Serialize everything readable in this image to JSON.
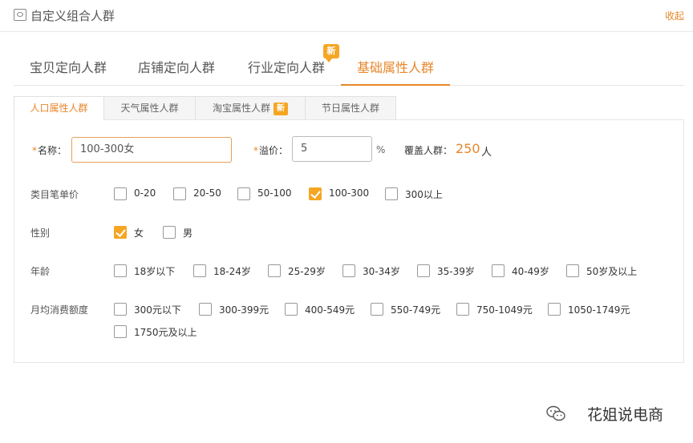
{
  "header": {
    "title": "自定义组合人群",
    "collapse": "收起"
  },
  "main_tabs": [
    {
      "label": "宝贝定向人群"
    },
    {
      "label": "店铺定向人群"
    },
    {
      "label": "行业定向人群",
      "badge": "新"
    },
    {
      "label": "基础属性人群",
      "active": true
    }
  ],
  "sub_tabs": [
    {
      "label": "人口属性人群",
      "active": true
    },
    {
      "label": "天气属性人群"
    },
    {
      "label": "淘宝属性人群",
      "badge": "新"
    },
    {
      "label": "节日属性人群"
    }
  ],
  "form": {
    "name_label": "名称：",
    "name_value": "100-300女",
    "premium_label": "溢价：",
    "premium_value": "5",
    "premium_unit": "%",
    "cover_label": "覆盖人群：",
    "cover_value": "250",
    "cover_unit": "人",
    "required_mark": "*"
  },
  "rows": {
    "price": {
      "label": "类目笔单价",
      "options": [
        {
          "label": "0-20",
          "checked": false
        },
        {
          "label": "20-50",
          "checked": false
        },
        {
          "label": "50-100",
          "checked": false
        },
        {
          "label": "100-300",
          "checked": true
        },
        {
          "label": "300以上",
          "checked": false
        }
      ]
    },
    "gender": {
      "label": "性别",
      "options": [
        {
          "label": "女",
          "checked": true
        },
        {
          "label": "男",
          "checked": false
        }
      ]
    },
    "age": {
      "label": "年龄",
      "options": [
        {
          "label": "18岁以下",
          "checked": false
        },
        {
          "label": "18-24岁",
          "checked": false
        },
        {
          "label": "25-29岁",
          "checked": false
        },
        {
          "label": "30-34岁",
          "checked": false
        },
        {
          "label": "35-39岁",
          "checked": false
        },
        {
          "label": "40-49岁",
          "checked": false
        },
        {
          "label": "50岁及以上",
          "checked": false
        }
      ]
    },
    "spend": {
      "label": "月均消费额度",
      "options": [
        {
          "label": "300元以下",
          "checked": false
        },
        {
          "label": "300-399元",
          "checked": false
        },
        {
          "label": "400-549元",
          "checked": false
        },
        {
          "label": "550-749元",
          "checked": false
        },
        {
          "label": "750-1049元",
          "checked": false
        },
        {
          "label": "1050-1749元",
          "checked": false
        },
        {
          "label": "1750元及以上",
          "checked": false
        }
      ]
    }
  },
  "watermark": {
    "text": "花姐说电商",
    "icon": "wechat-icon"
  },
  "colors": {
    "accent": "#e8862a",
    "badge": "#f5a623"
  }
}
